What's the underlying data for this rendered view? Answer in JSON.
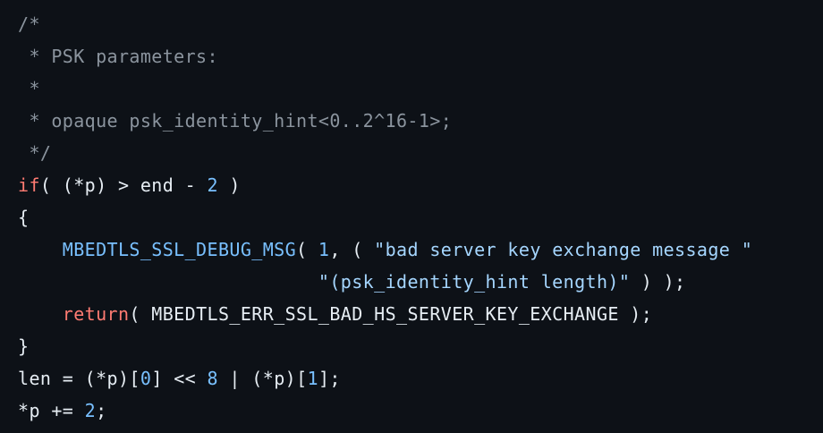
{
  "theme": {
    "background": "#0d1117",
    "text": "#e6edf3",
    "comment": "#8b949e",
    "keyword": "#ff7b72",
    "function": "#79c0ff",
    "number": "#79c0ff",
    "string": "#a5d6ff"
  },
  "code": {
    "lines": [
      [
        {
          "t": "comment",
          "s": "/*"
        }
      ],
      [
        {
          "t": "comment",
          "s": " * PSK parameters:"
        }
      ],
      [
        {
          "t": "comment",
          "s": " *"
        }
      ],
      [
        {
          "t": "comment",
          "s": " * opaque psk_identity_hint<0..2^16-1>;"
        }
      ],
      [
        {
          "t": "comment",
          "s": " */"
        }
      ],
      [
        {
          "t": "keyword",
          "s": "if"
        },
        {
          "t": "plain",
          "s": "( (*p) > end - "
        },
        {
          "t": "num",
          "s": "2"
        },
        {
          "t": "plain",
          "s": " )"
        }
      ],
      [
        {
          "t": "plain",
          "s": "{"
        }
      ],
      [
        {
          "t": "plain",
          "s": "    "
        },
        {
          "t": "func",
          "s": "MBEDTLS_SSL_DEBUG_MSG"
        },
        {
          "t": "plain",
          "s": "( "
        },
        {
          "t": "num",
          "s": "1"
        },
        {
          "t": "plain",
          "s": ", ( "
        },
        {
          "t": "string",
          "s": "\"bad server key exchange message \""
        }
      ],
      [
        {
          "t": "plain",
          "s": "                           "
        },
        {
          "t": "string",
          "s": "\"(psk_identity_hint length)\""
        },
        {
          "t": "plain",
          "s": " ) );"
        }
      ],
      [
        {
          "t": "plain",
          "s": "    "
        },
        {
          "t": "keyword",
          "s": "return"
        },
        {
          "t": "plain",
          "s": "( MBEDTLS_ERR_SSL_BAD_HS_SERVER_KEY_EXCHANGE );"
        }
      ],
      [
        {
          "t": "plain",
          "s": "}"
        }
      ],
      [
        {
          "t": "plain",
          "s": "len = (*p)["
        },
        {
          "t": "num",
          "s": "0"
        },
        {
          "t": "plain",
          "s": "] << "
        },
        {
          "t": "num",
          "s": "8"
        },
        {
          "t": "plain",
          "s": " | (*p)["
        },
        {
          "t": "num",
          "s": "1"
        },
        {
          "t": "plain",
          "s": "];"
        }
      ],
      [
        {
          "t": "plain",
          "s": "*p += "
        },
        {
          "t": "num",
          "s": "2"
        },
        {
          "t": "plain",
          "s": ";"
        }
      ]
    ]
  }
}
